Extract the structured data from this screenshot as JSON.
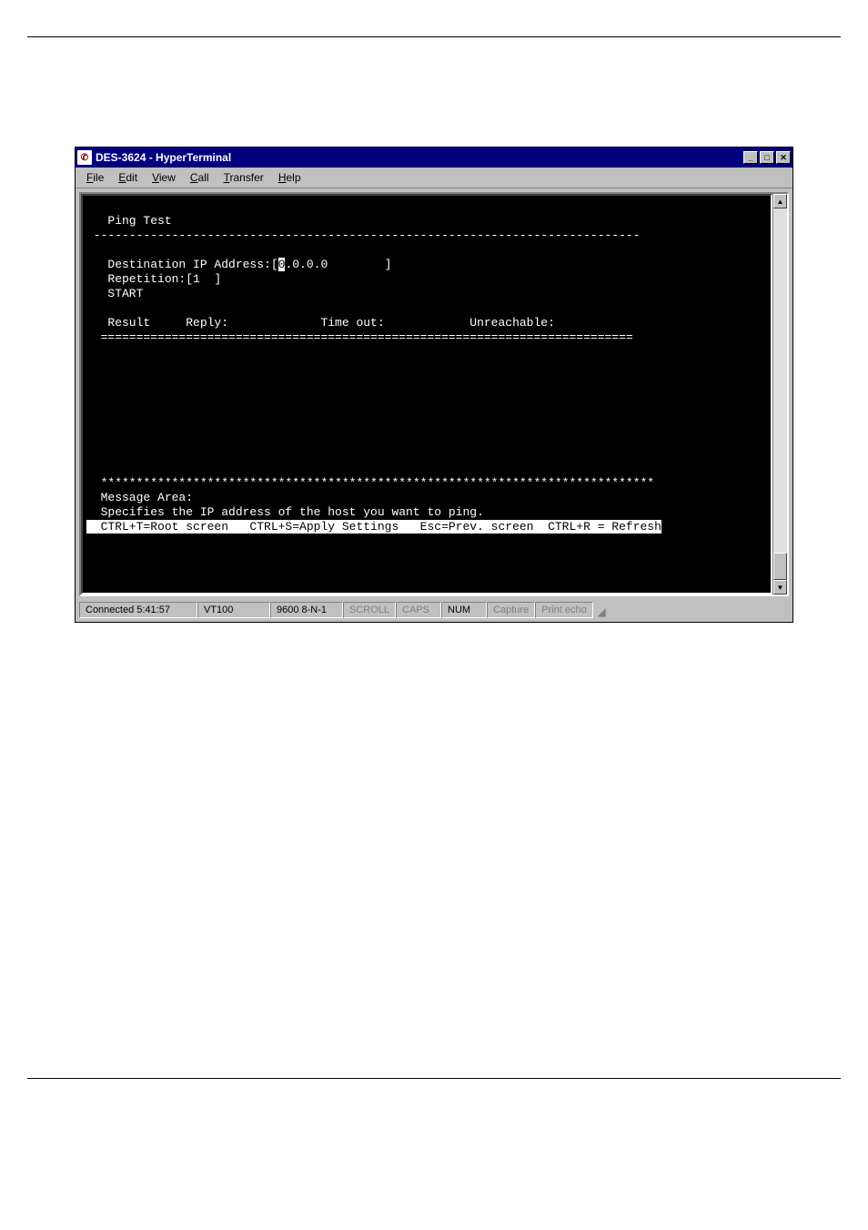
{
  "window": {
    "title": "DES-3624 - HyperTerminal"
  },
  "menu": {
    "file": "File",
    "edit": "Edit",
    "view": "View",
    "call": "Call",
    "transfer": "Transfer",
    "help": "Help"
  },
  "terminal": {
    "l1": "",
    "l2": "   Ping Test",
    "l3": " -----------------------------------------------------------------------------",
    "l4": "",
    "l5a": "   Destination IP Address:[",
    "l5b": "0",
    "l5c": ".0.0.0        ]",
    "l6": "   Repetition:[1  ]",
    "l7": "   START",
    "l8": "",
    "l9": "   Result     Reply:             Time out:            Unreachable:",
    "l10": "  ===========================================================================",
    "l11": "",
    "l12": "",
    "l13": "",
    "l14": "",
    "l15": "",
    "l16": "",
    "l17": "",
    "l18": "",
    "l19": "",
    "l20": "  ******************************************************************************",
    "l21": "  Message Area:",
    "l22": "  Specifies the IP address of the host you want to ping.",
    "l23": "  CTRL+T=Root screen   CTRL+S=Apply Settings   Esc=Prev. screen  CTRL+R = Refresh"
  },
  "status": {
    "connected": "Connected 5:41:57",
    "emulation": "VT100",
    "settings": "9600 8-N-1",
    "scroll": "SCROLL",
    "caps": "CAPS",
    "num": "NUM",
    "capture": "Capture",
    "printecho": "Print echo"
  }
}
